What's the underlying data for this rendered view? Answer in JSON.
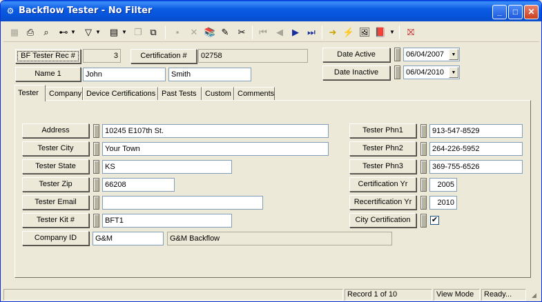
{
  "window": {
    "title": "Backflow Tester - No Filter"
  },
  "header": {
    "rec_label": "BF Tester Rec #",
    "rec_value": "3",
    "cert_label": "Certification #",
    "cert_value": "02758",
    "name_label": "Name 1",
    "first_name": "John",
    "last_name": "Smith",
    "date_active_label": "Date Active",
    "date_active": "06/04/2007",
    "date_inactive_label": "Date Inactive",
    "date_inactive": "06/04/2010"
  },
  "tabs": [
    "Tester",
    "Company",
    "Device Certifications",
    "Past Tests",
    "Custom",
    "Comments"
  ],
  "tester": {
    "address_label": "Address",
    "address": "10245 E107th St.",
    "city_label": "Tester City",
    "city": "Your Town",
    "state_label": "Tester State",
    "state": "KS",
    "zip_label": "Tester Zip",
    "zip": "66208",
    "email_label": "Tester Email",
    "email": "",
    "kit_label": "Tester Kit #",
    "kit": "BFT1",
    "company_label": "Company ID",
    "company_id": "G&M",
    "company_name": "G&M Backflow",
    "phn1_label": "Tester Phn1",
    "phn1": "913-547-8529",
    "phn2_label": "Tester Phn2",
    "phn2": "264-226-5952",
    "phn3_label": "Tester Phn3",
    "phn3": "369-755-6526",
    "cert_yr_label": "Certification Yr",
    "cert_yr": "2005",
    "recert_yr_label": "Recertification Yr",
    "recert_yr": "2010",
    "city_cert_label": "City Certification",
    "city_cert_checked": "✔"
  },
  "status": {
    "record": "Record 1 of 10",
    "mode": "View Mode",
    "state": "Ready..."
  },
  "icons": {
    "app": "backflow-app-icon",
    "minimize": "minimize-icon",
    "maximize": "maximize-icon",
    "close": "close-icon"
  },
  "colors": {
    "titlebar": "#0653d8",
    "face": "#ece9d8",
    "field_border": "#7f9db9"
  }
}
